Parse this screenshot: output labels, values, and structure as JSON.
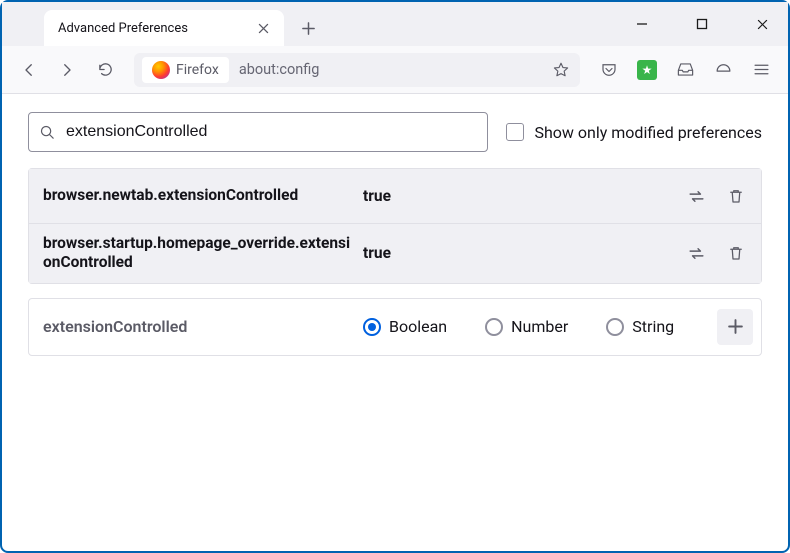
{
  "window": {
    "tab_title": "Advanced Preferences"
  },
  "toolbar": {
    "identity_label": "Firefox",
    "url": "about:config"
  },
  "config": {
    "search_value": "extensionControlled",
    "show_only_modified_label": "Show only modified preferences",
    "prefs": [
      {
        "name": "browser.newtab.extensionControlled",
        "value": "true"
      },
      {
        "name": "browser.startup.homepage_override.extensionControlled",
        "value": "true"
      }
    ],
    "new_pref": {
      "name": "extensionControlled",
      "types": [
        "Boolean",
        "Number",
        "String"
      ],
      "selected": "Boolean"
    }
  }
}
